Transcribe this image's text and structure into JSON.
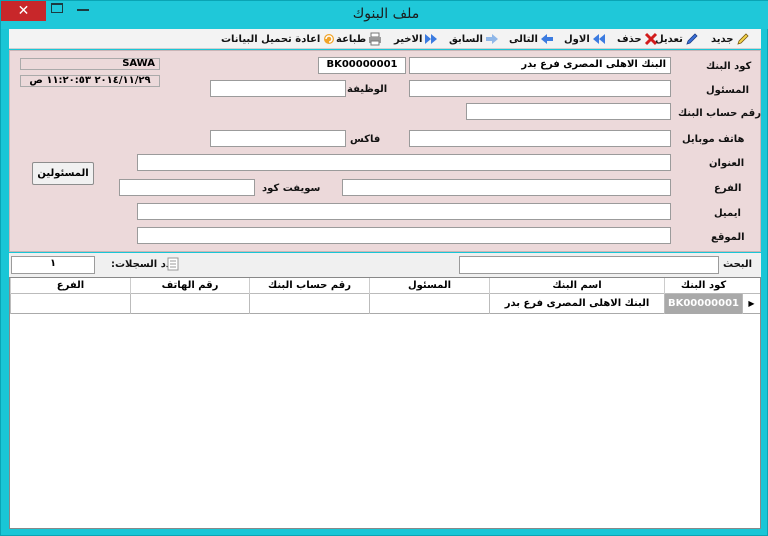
{
  "window": {
    "title": "ملف البنوك",
    "close_glyph": "✕"
  },
  "toolbar": {
    "new": "جديد",
    "edit": "تعديل",
    "delete": "حذف",
    "first": "الاول",
    "next": "التالى",
    "previous": "السابق",
    "last": "الاخير",
    "print": "طباعة",
    "reload": "اعادة تحميل البيانات"
  },
  "info": {
    "user": "SAWA",
    "datetime": "٢٠١٤/١١/٢٩ ١١:٢٠:٥٣ ص"
  },
  "form": {
    "bank_code_label": "كود البنك",
    "bank_code_value": "BK00000001",
    "bank_name_value": "البنك الاهلى المصرى فرع بدر",
    "manager_label": "المسئول",
    "manager_value": "",
    "job_label": "الوظيفة",
    "job_value": "",
    "account_no_label": "رقم حساب البنك",
    "account_no_value": "",
    "mobile_label": "هاتف موبايل",
    "mobile_value": "",
    "fax_label": "فاكس",
    "fax_value": "",
    "address_label": "العنوان",
    "address_value": "",
    "branch_label": "الفرع",
    "branch_value": "",
    "swift_label": "سويفت كود",
    "swift_value": "",
    "email_label": "ايميل",
    "email_value": "",
    "website_label": "الموقع",
    "website_value": "",
    "managers_button": "المسئولين"
  },
  "search": {
    "label": "البحث",
    "value": "",
    "count_label": "عدد السجلات:",
    "count_value": "١"
  },
  "grid": {
    "columns": [
      "كود البنك",
      "اسم البنك",
      "المسئول",
      "رقم حساب البنك",
      "رقم الهاتف",
      "الفرع"
    ],
    "rows": [
      [
        "BK00000001",
        "البنك الاهلى المصرى فرع بدر",
        "",
        "",
        "",
        ""
      ]
    ],
    "row_indicator": "▶"
  },
  "colors": {
    "accent": "#1cc7d8",
    "form_bg": "#ecd9da",
    "close": "#c8272a"
  }
}
